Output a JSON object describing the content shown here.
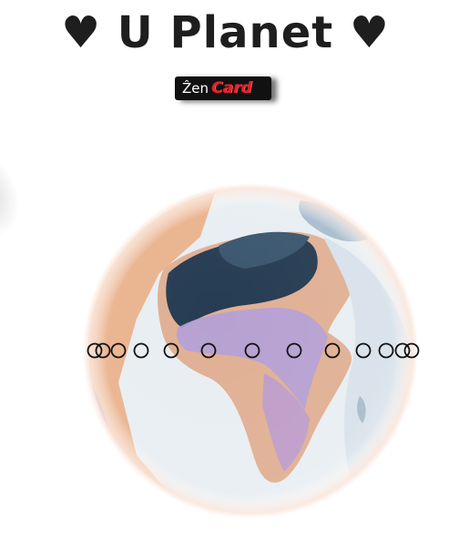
{
  "header": {
    "title": "♥ U Planet ♥"
  },
  "badge": {
    "prefix": "Ẑen",
    "name": "Card"
  },
  "globe": {
    "icon": "globe-icon",
    "colors": {
      "land": "#e8b08c",
      "ocean": "#dfe8ee",
      "dark_region": "#243a50",
      "violet_region": "#b19cd6",
      "rim": "#fbe7dc"
    }
  },
  "markers": {
    "icon": "ring-marker-icon",
    "count": 14
  }
}
